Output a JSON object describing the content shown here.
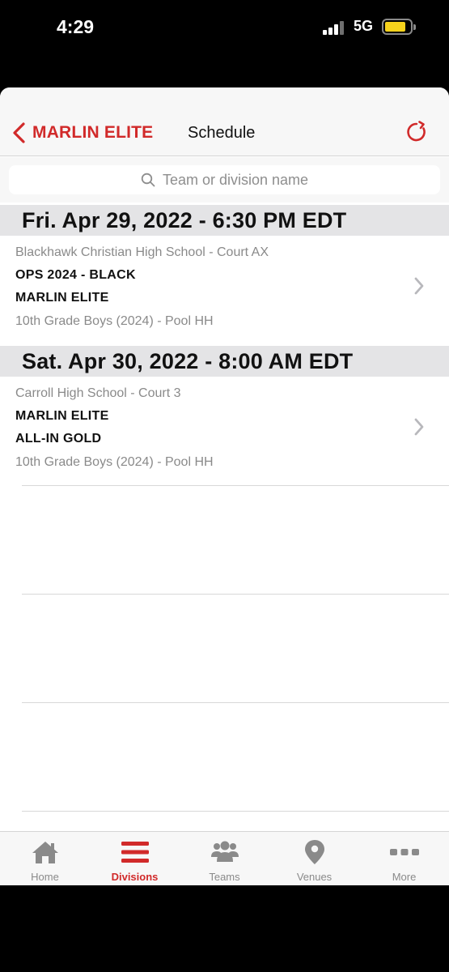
{
  "status_bar": {
    "time": "4:29",
    "network": "5G"
  },
  "nav": {
    "back_label": "MARLIN ELITE",
    "title": "Schedule"
  },
  "search": {
    "placeholder": "Team or division name"
  },
  "schedule": [
    {
      "date_header": "Fri. Apr 29, 2022 - 6:30 PM EDT",
      "venue": "Blackhawk Christian High School - Court AX",
      "team1": "OPS 2024 - BLACK",
      "team2": "MARLIN ELITE",
      "division": "10th Grade Boys (2024) - Pool HH"
    },
    {
      "date_header": "Sat. Apr 30, 2022 - 8:00 AM EDT",
      "venue": "Carroll High School - Court 3",
      "team1": "MARLIN ELITE",
      "team2": "ALL-IN GOLD",
      "division": "10th Grade Boys (2024) - Pool HH"
    }
  ],
  "tabbar": {
    "tabs": [
      {
        "label": "Home",
        "icon": "home-icon"
      },
      {
        "label": "Divisions",
        "icon": "divisions-icon",
        "active": true
      },
      {
        "label": "Teams",
        "icon": "teams-icon"
      },
      {
        "label": "Venues",
        "icon": "location-pin-icon"
      },
      {
        "label": "More",
        "icon": "more-dots-icon"
      }
    ]
  },
  "colors": {
    "accent": "#d12a2a",
    "tab_inactive": "#8a8a8a",
    "header_bg": "#e4e4e6"
  }
}
